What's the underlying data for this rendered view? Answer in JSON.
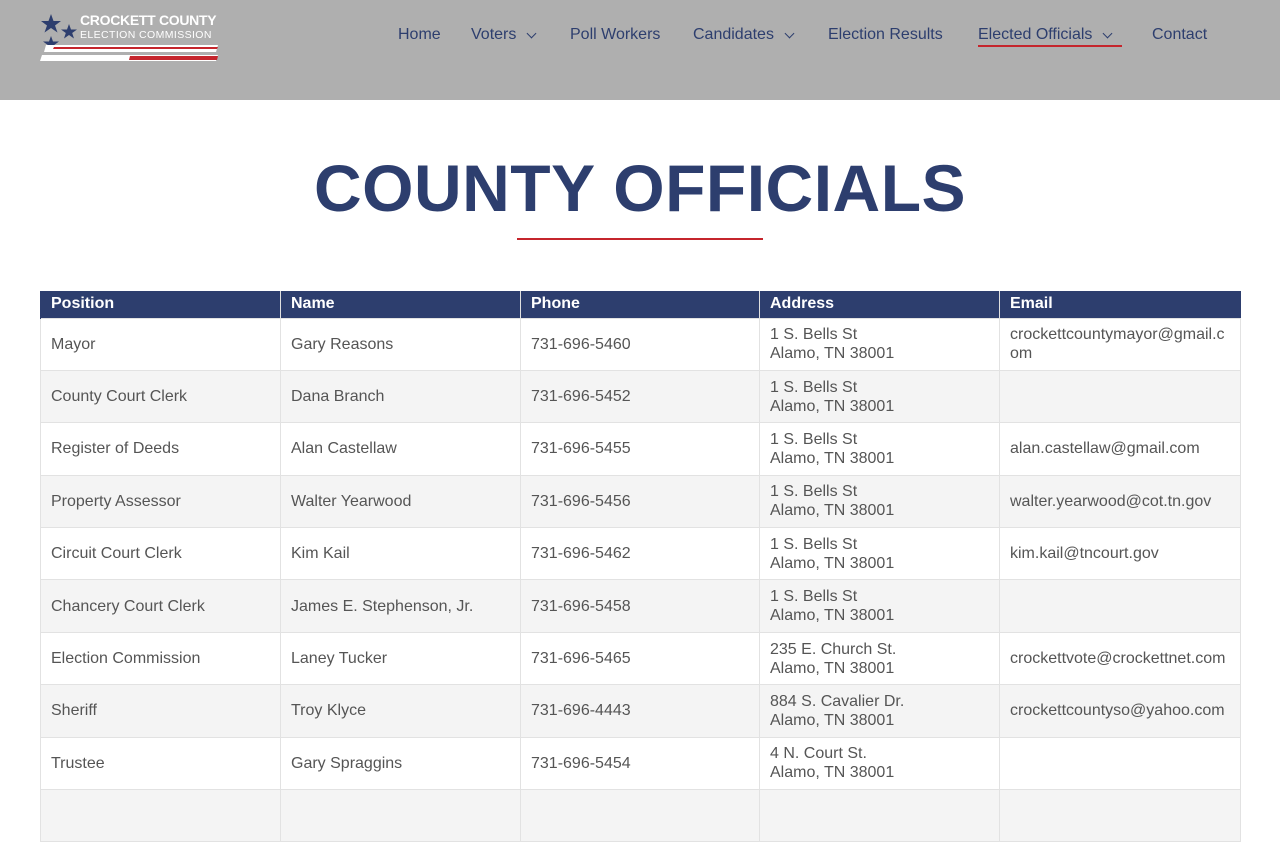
{
  "logo": {
    "line1": "CROCKETT COUNTY",
    "line2": "ELECTION COMMISSION"
  },
  "nav": {
    "items": [
      {
        "label": "Home",
        "dropdown": false
      },
      {
        "label": "Voters",
        "dropdown": true
      },
      {
        "label": "Poll Workers",
        "dropdown": false
      },
      {
        "label": "Candidates",
        "dropdown": true
      },
      {
        "label": "Election Results",
        "dropdown": false
      },
      {
        "label": "Elected Officials",
        "dropdown": true,
        "active": true
      },
      {
        "label": "Contact",
        "dropdown": false
      }
    ]
  },
  "page": {
    "title": "COUNTY OFFICIALS"
  },
  "table": {
    "headers": [
      "Position",
      "Name",
      "Phone",
      "Address",
      "Email"
    ],
    "rows": [
      {
        "position": "Mayor",
        "name": "Gary Reasons",
        "phone": "731-696-5460",
        "address1": "1 S. Bells St",
        "address2": "Alamo, TN 38001",
        "email": "crockettcountymayor@gmail.com"
      },
      {
        "position": "County Court Clerk",
        "name": "Dana Branch",
        "phone": "731-696-5452",
        "address1": "1 S. Bells St",
        "address2": "Alamo, TN 38001",
        "email": ""
      },
      {
        "position": "Register of Deeds",
        "name": "Alan Castellaw",
        "phone": "731-696-5455",
        "address1": "1 S. Bells St",
        "address2": "Alamo, TN 38001",
        "email": "alan.castellaw@gmail.com"
      },
      {
        "position": "Property Assessor",
        "name": "Walter Yearwood",
        "phone": "731-696-5456",
        "address1": "1 S. Bells St",
        "address2": "Alamo, TN 38001",
        "email": "walter.yearwood@cot.tn.gov"
      },
      {
        "position": "Circuit Court Clerk",
        "name": "Kim Kail",
        "phone": "731-696-5462",
        "address1": "1 S. Bells St",
        "address2": "Alamo, TN 38001",
        "email": "kim.kail@tncourt.gov"
      },
      {
        "position": "Chancery Court Clerk",
        "name": "James E. Stephenson, Jr.",
        "phone": "731-696-5458",
        "address1": "1 S. Bells St",
        "address2": "Alamo, TN 38001",
        "email": ""
      },
      {
        "position": "Election Commission",
        "name": "Laney Tucker",
        "phone": "731-696-5465",
        "address1": "235 E. Church St.",
        "address2": "Alamo, TN 38001",
        "email": "crockettvote@crockettnet.com"
      },
      {
        "position": "Sheriff",
        "name": "Troy Klyce",
        "phone": "731-696-4443",
        "address1": "884 S. Cavalier Dr.",
        "address2": "Alamo, TN 38001",
        "email": "crockettcountyso@yahoo.com"
      },
      {
        "position": "Trustee",
        "name": "Gary Spraggins",
        "phone": "731-696-5454",
        "address1": "4 N. Court St.",
        "address2": "Alamo, TN 38001",
        "email": ""
      }
    ]
  },
  "colors": {
    "header_bg": "#afafaf",
    "brand_navy": "#2d3e6e",
    "accent_red": "#c5252c"
  }
}
